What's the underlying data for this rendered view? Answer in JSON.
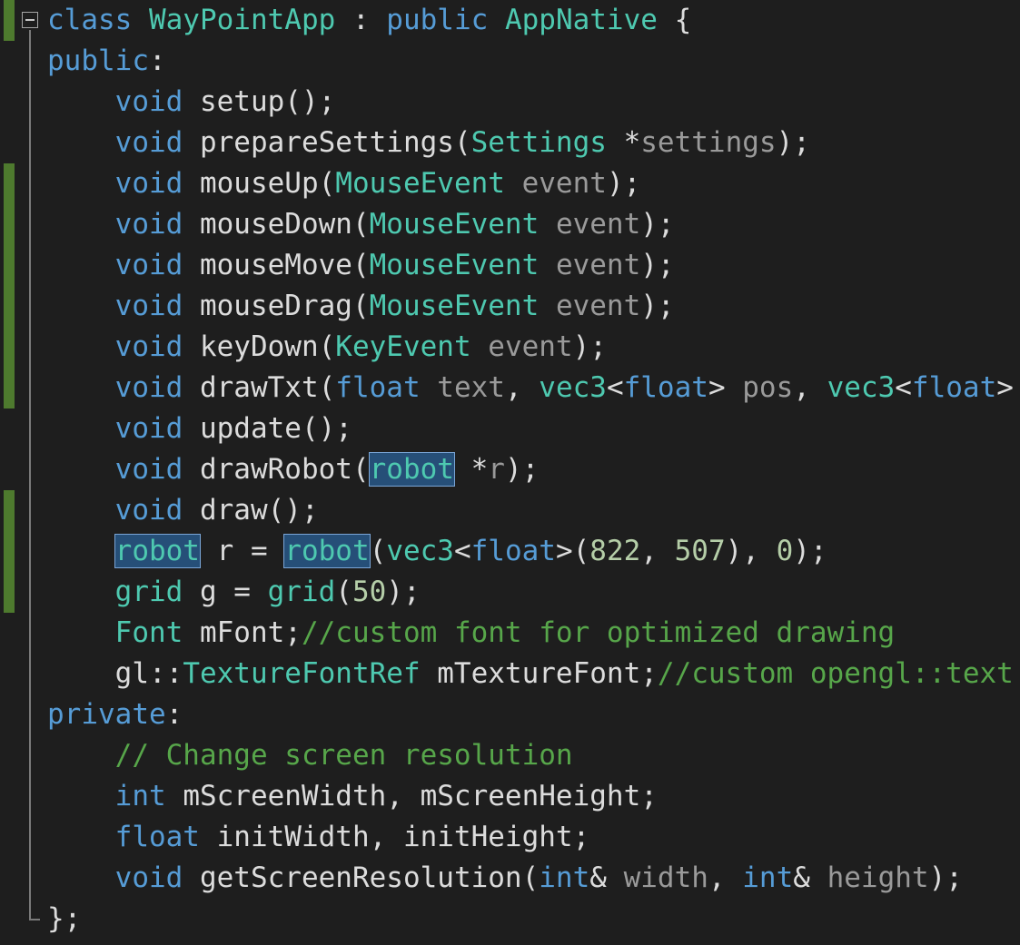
{
  "colors": {
    "background": "#1e1e1e",
    "keyword": "#569cd6",
    "type": "#4ec9b0",
    "comment": "#57a64a",
    "number": "#b5cea8",
    "parameter": "#9a9a9a",
    "plain": "#dcdcdc",
    "change_bar": "#4e7a2e",
    "selection": "#264f78"
  },
  "code": {
    "lines": [
      {
        "changed": true,
        "tokens": [
          {
            "t": "class ",
            "c": "keyword"
          },
          {
            "t": "WayPointApp",
            "c": "type"
          },
          {
            "t": " : ",
            "c": "plain"
          },
          {
            "t": "public ",
            "c": "keyword"
          },
          {
            "t": "AppNative",
            "c": "type"
          },
          {
            "t": " {",
            "c": "plain"
          }
        ]
      },
      {
        "changed": false,
        "tokens": [
          {
            "t": "public",
            "c": "keyword"
          },
          {
            "t": ":",
            "c": "plain"
          }
        ]
      },
      {
        "changed": false,
        "tokens": [
          {
            "t": "    ",
            "c": "plain"
          },
          {
            "t": "void ",
            "c": "keyword"
          },
          {
            "t": "setup();",
            "c": "plain"
          }
        ]
      },
      {
        "changed": false,
        "tokens": [
          {
            "t": "    ",
            "c": "plain"
          },
          {
            "t": "void ",
            "c": "keyword"
          },
          {
            "t": "prepareSettings(",
            "c": "plain"
          },
          {
            "t": "Settings",
            "c": "type"
          },
          {
            "t": " *",
            "c": "plain"
          },
          {
            "t": "settings",
            "c": "parameter"
          },
          {
            "t": ");",
            "c": "plain"
          }
        ]
      },
      {
        "changed": true,
        "tokens": [
          {
            "t": "    ",
            "c": "plain"
          },
          {
            "t": "void ",
            "c": "keyword"
          },
          {
            "t": "mouseUp(",
            "c": "plain"
          },
          {
            "t": "MouseEvent",
            "c": "type"
          },
          {
            "t": " ",
            "c": "plain"
          },
          {
            "t": "event",
            "c": "parameter"
          },
          {
            "t": ");",
            "c": "plain"
          }
        ]
      },
      {
        "changed": true,
        "tokens": [
          {
            "t": "    ",
            "c": "plain"
          },
          {
            "t": "void ",
            "c": "keyword"
          },
          {
            "t": "mouseDown(",
            "c": "plain"
          },
          {
            "t": "MouseEvent",
            "c": "type"
          },
          {
            "t": " ",
            "c": "plain"
          },
          {
            "t": "event",
            "c": "parameter"
          },
          {
            "t": ");",
            "c": "plain"
          }
        ]
      },
      {
        "changed": true,
        "tokens": [
          {
            "t": "    ",
            "c": "plain"
          },
          {
            "t": "void ",
            "c": "keyword"
          },
          {
            "t": "mouseMove(",
            "c": "plain"
          },
          {
            "t": "MouseEvent",
            "c": "type"
          },
          {
            "t": " ",
            "c": "plain"
          },
          {
            "t": "event",
            "c": "parameter"
          },
          {
            "t": ");",
            "c": "plain"
          }
        ]
      },
      {
        "changed": true,
        "tokens": [
          {
            "t": "    ",
            "c": "plain"
          },
          {
            "t": "void ",
            "c": "keyword"
          },
          {
            "t": "mouseDrag(",
            "c": "plain"
          },
          {
            "t": "MouseEvent",
            "c": "type"
          },
          {
            "t": " ",
            "c": "plain"
          },
          {
            "t": "event",
            "c": "parameter"
          },
          {
            "t": ");",
            "c": "plain"
          }
        ]
      },
      {
        "changed": true,
        "tokens": [
          {
            "t": "    ",
            "c": "plain"
          },
          {
            "t": "void ",
            "c": "keyword"
          },
          {
            "t": "keyDown(",
            "c": "plain"
          },
          {
            "t": "KeyEvent",
            "c": "type"
          },
          {
            "t": " ",
            "c": "plain"
          },
          {
            "t": "event",
            "c": "parameter"
          },
          {
            "t": ");",
            "c": "plain"
          }
        ]
      },
      {
        "changed": true,
        "tokens": [
          {
            "t": "    ",
            "c": "plain"
          },
          {
            "t": "void ",
            "c": "keyword"
          },
          {
            "t": "drawTxt(",
            "c": "plain"
          },
          {
            "t": "float",
            "c": "keyword"
          },
          {
            "t": " ",
            "c": "plain"
          },
          {
            "t": "text",
            "c": "parameter"
          },
          {
            "t": ", ",
            "c": "plain"
          },
          {
            "t": "vec3",
            "c": "type"
          },
          {
            "t": "<",
            "c": "plain"
          },
          {
            "t": "float",
            "c": "keyword"
          },
          {
            "t": "> ",
            "c": "plain"
          },
          {
            "t": "pos",
            "c": "parameter"
          },
          {
            "t": ", ",
            "c": "plain"
          },
          {
            "t": "vec3",
            "c": "type"
          },
          {
            "t": "<",
            "c": "plain"
          },
          {
            "t": "float",
            "c": "keyword"
          },
          {
            "t": ">",
            "c": "plain"
          }
        ]
      },
      {
        "changed": false,
        "tokens": [
          {
            "t": "    ",
            "c": "plain"
          },
          {
            "t": "void ",
            "c": "keyword"
          },
          {
            "t": "update();",
            "c": "plain"
          }
        ]
      },
      {
        "changed": false,
        "tokens": [
          {
            "t": "    ",
            "c": "plain"
          },
          {
            "t": "void ",
            "c": "keyword"
          },
          {
            "t": "drawRobot(",
            "c": "plain"
          },
          {
            "t": "robot",
            "c": "type",
            "hl": true
          },
          {
            "t": " *",
            "c": "plain"
          },
          {
            "t": "r",
            "c": "parameter"
          },
          {
            "t": ");",
            "c": "plain"
          }
        ]
      },
      {
        "changed": true,
        "tokens": [
          {
            "t": "    ",
            "c": "plain"
          },
          {
            "t": "void ",
            "c": "keyword"
          },
          {
            "t": "draw();",
            "c": "plain"
          }
        ]
      },
      {
        "changed": true,
        "tokens": [
          {
            "t": "    ",
            "c": "plain"
          },
          {
            "t": "robot",
            "c": "type",
            "hl": true
          },
          {
            "t": " r = ",
            "c": "plain"
          },
          {
            "t": "robot",
            "c": "type",
            "hl": true
          },
          {
            "t": "(",
            "c": "plain"
          },
          {
            "t": "vec3",
            "c": "type"
          },
          {
            "t": "<",
            "c": "plain"
          },
          {
            "t": "float",
            "c": "keyword"
          },
          {
            "t": ">(",
            "c": "plain"
          },
          {
            "t": "822",
            "c": "number"
          },
          {
            "t": ", ",
            "c": "plain"
          },
          {
            "t": "507",
            "c": "number"
          },
          {
            "t": "), ",
            "c": "plain"
          },
          {
            "t": "0",
            "c": "number"
          },
          {
            "t": ");",
            "c": "plain"
          }
        ]
      },
      {
        "changed": true,
        "tokens": [
          {
            "t": "    ",
            "c": "plain"
          },
          {
            "t": "grid",
            "c": "type"
          },
          {
            "t": " g = ",
            "c": "plain"
          },
          {
            "t": "grid",
            "c": "type"
          },
          {
            "t": "(",
            "c": "plain"
          },
          {
            "t": "50",
            "c": "number"
          },
          {
            "t": ");",
            "c": "plain"
          }
        ]
      },
      {
        "changed": false,
        "tokens": [
          {
            "t": "    ",
            "c": "plain"
          },
          {
            "t": "Font",
            "c": "type"
          },
          {
            "t": " mFont;",
            "c": "plain"
          },
          {
            "t": "//custom font for optimized drawing",
            "c": "comment"
          }
        ]
      },
      {
        "changed": false,
        "tokens": [
          {
            "t": "    ",
            "c": "plain"
          },
          {
            "t": "gl::",
            "c": "plain"
          },
          {
            "t": "TextureFontRef",
            "c": "type"
          },
          {
            "t": " mTextureFont;",
            "c": "plain"
          },
          {
            "t": "//custom opengl::text",
            "c": "comment"
          }
        ]
      },
      {
        "changed": false,
        "tokens": [
          {
            "t": "private",
            "c": "keyword"
          },
          {
            "t": ":",
            "c": "plain"
          }
        ]
      },
      {
        "changed": false,
        "tokens": [
          {
            "t": "    ",
            "c": "plain"
          },
          {
            "t": "// Change screen resolution",
            "c": "comment"
          }
        ]
      },
      {
        "changed": false,
        "tokens": [
          {
            "t": "    ",
            "c": "plain"
          },
          {
            "t": "int ",
            "c": "keyword"
          },
          {
            "t": "mScreenWidth, mScreenHeight;",
            "c": "plain"
          }
        ]
      },
      {
        "changed": false,
        "tokens": [
          {
            "t": "    ",
            "c": "plain"
          },
          {
            "t": "float ",
            "c": "keyword"
          },
          {
            "t": "initWidth, initHeight;",
            "c": "plain"
          }
        ]
      },
      {
        "changed": false,
        "tokens": [
          {
            "t": "    ",
            "c": "plain"
          },
          {
            "t": "void ",
            "c": "keyword"
          },
          {
            "t": "getScreenResolution(",
            "c": "plain"
          },
          {
            "t": "int",
            "c": "keyword"
          },
          {
            "t": "& ",
            "c": "plain"
          },
          {
            "t": "width",
            "c": "parameter"
          },
          {
            "t": ", ",
            "c": "plain"
          },
          {
            "t": "int",
            "c": "keyword"
          },
          {
            "t": "& ",
            "c": "plain"
          },
          {
            "t": "height",
            "c": "parameter"
          },
          {
            "t": ");",
            "c": "plain"
          }
        ]
      },
      {
        "changed": false,
        "tokens": [
          {
            "t": "};",
            "c": "plain"
          }
        ]
      }
    ]
  }
}
